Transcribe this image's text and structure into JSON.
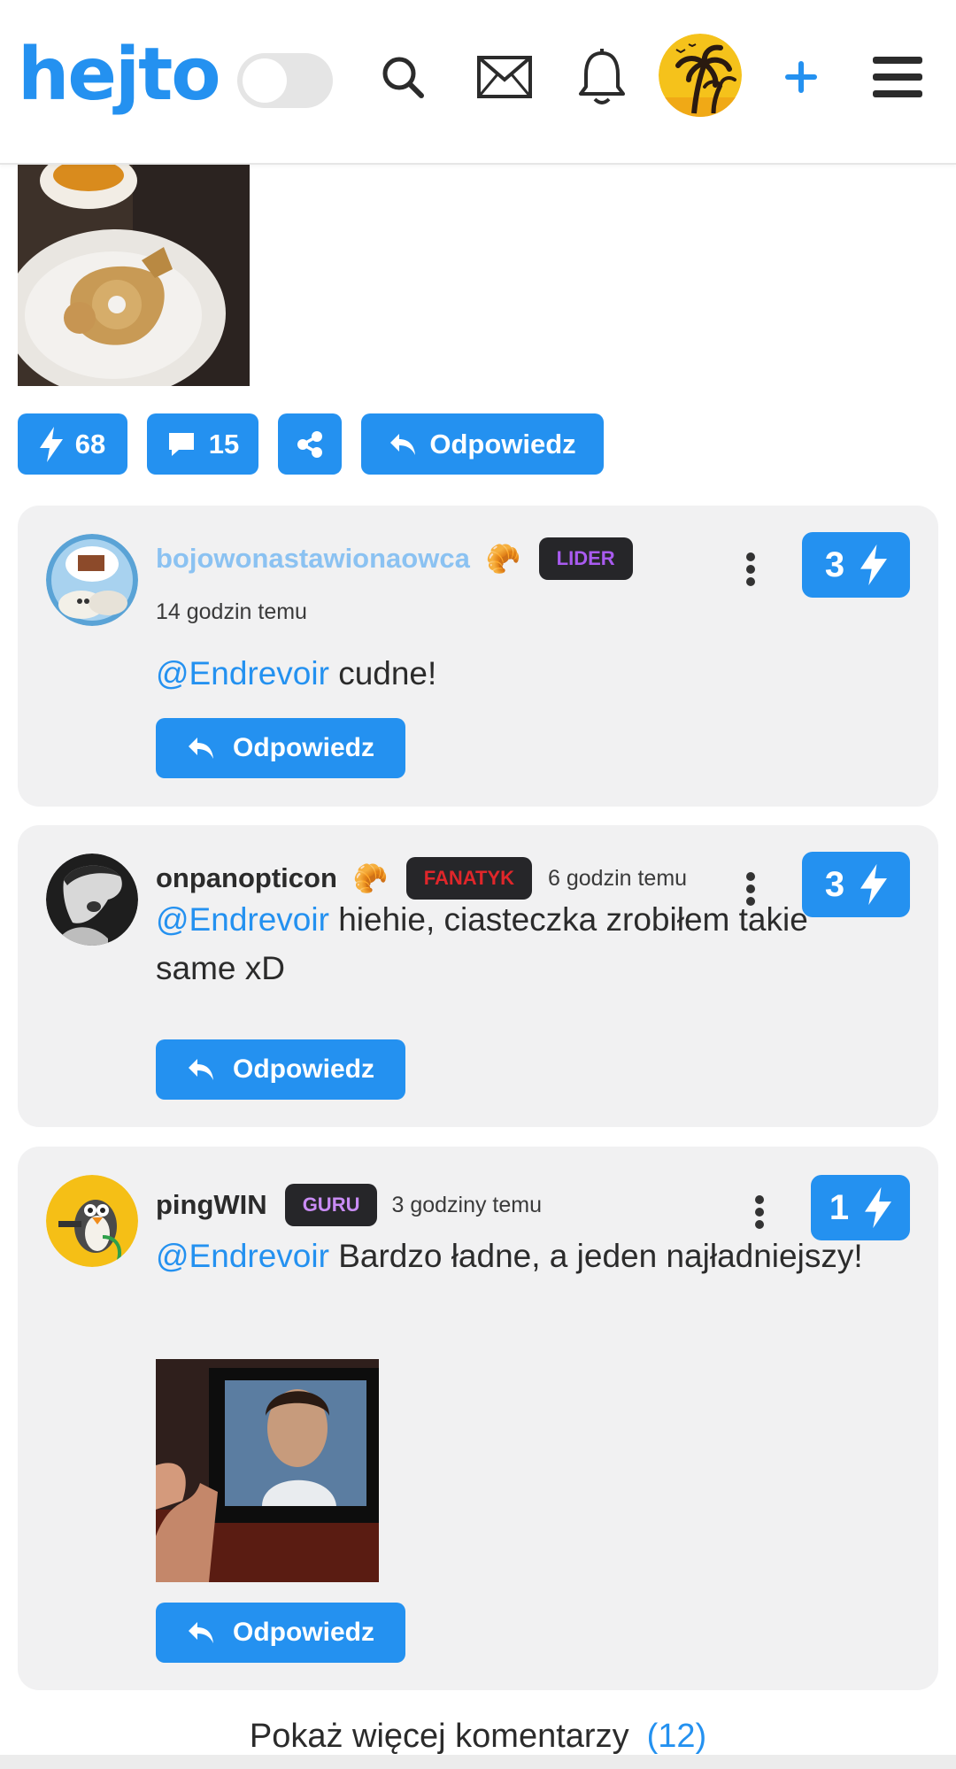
{
  "header": {
    "logo": "hejto",
    "dark_mode_toggle": "off"
  },
  "post": {
    "actions": {
      "likes": "68",
      "comments": "15",
      "reply_label": "Odpowiedz"
    }
  },
  "comments": [
    {
      "username": "bojowonastawionaowca",
      "emoji": "🥐",
      "rank": "LIDER",
      "rank_color": "#a95bf0",
      "time": "14 godzin temu",
      "mention": "@Endrevoir",
      "text": " cudne!",
      "votes": "3",
      "reply_label": "Odpowiedz"
    },
    {
      "username": "onpanopticon",
      "emoji": "🥐",
      "rank": "FANATYK",
      "rank_color": "#e0262a",
      "time": "6 godzin temu",
      "mention": "@Endrevoir",
      "text": " hiehie, ciasteczka zrobiłem takie same xD",
      "votes": "3",
      "reply_label": "Odpowiedz"
    },
    {
      "username": "pingWIN",
      "rank": "GURU",
      "rank_color": "#c98cf4",
      "time": "3 godziny temu",
      "mention": "@Endrevoir",
      "text": " Bardzo ładne, a jeden najładniejszy!",
      "votes": "1",
      "reply_label": "Odpowiedz"
    }
  ],
  "show_more": {
    "label": "Pokaż więcej komentarzy",
    "count": "(12)"
  },
  "colors": {
    "accent": "#2491f0",
    "card_bg": "#f1f1f2",
    "username_highlight": "#8bc2f2"
  }
}
